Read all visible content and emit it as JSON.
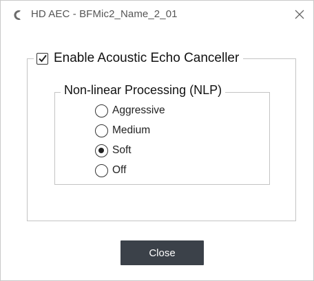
{
  "window": {
    "title": "HD AEC - BFMic2_Name_2_01",
    "app_icon": "crescent-c-icon",
    "close_icon": "close-icon"
  },
  "aec": {
    "enable_label": "Enable Acoustic Echo Canceller",
    "enabled": true
  },
  "nlp": {
    "group_label": "Non-linear Processing (NLP)",
    "options": [
      {
        "label": "Aggressive",
        "selected": false
      },
      {
        "label": "Medium",
        "selected": false
      },
      {
        "label": "Soft",
        "selected": true
      },
      {
        "label": "Off",
        "selected": false
      }
    ]
  },
  "footer": {
    "close_label": "Close"
  }
}
